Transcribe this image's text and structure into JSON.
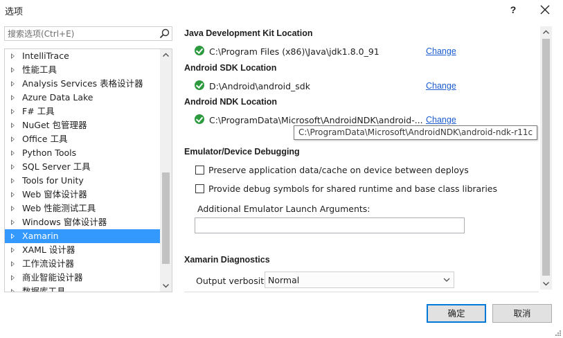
{
  "window": {
    "title": "选项",
    "help_label": "?"
  },
  "search": {
    "placeholder": "搜索选项(Ctrl+E)"
  },
  "tree": {
    "items": [
      {
        "label": "IntelliTrace"
      },
      {
        "label": "性能工具"
      },
      {
        "label": "Analysis Services 表格设计器"
      },
      {
        "label": "Azure Data Lake"
      },
      {
        "label": "F# 工具"
      },
      {
        "label": "NuGet 包管理器"
      },
      {
        "label": "Office 工具"
      },
      {
        "label": "Python Tools"
      },
      {
        "label": "SQL Server 工具"
      },
      {
        "label": "Tools for Unity"
      },
      {
        "label": "Web 窗体设计器"
      },
      {
        "label": "Web 性能测试工具"
      },
      {
        "label": "Windows 窗体设计器"
      },
      {
        "label": "Xamarin",
        "selected": true
      },
      {
        "label": "XAML 设计器"
      },
      {
        "label": "工作流设计器"
      },
      {
        "label": "商业智能设计器"
      },
      {
        "label": "数据库工具"
      }
    ]
  },
  "sdk": {
    "java_title": "Java Development Kit Location",
    "java_path": "C:\\Program Files (x86)\\Java\\jdk1.8.0_91",
    "android_sdk_title": "Android SDK Location",
    "android_sdk_path": "D:\\Android\\android_sdk",
    "android_ndk_title": "Android NDK Location",
    "android_ndk_path": "C:\\ProgramData\\Microsoft\\AndroidNDK\\android-...",
    "change_label": "Change",
    "ndk_tooltip": "C:\\ProgramData\\Microsoft\\AndroidNDK\\android-ndk-r11c"
  },
  "emulator": {
    "title": "Emulator/Device Debugging",
    "preserve_label": "Preserve application data/cache on device between deploys",
    "preserve_checked": false,
    "debug_symbols_label": "Provide debug symbols for shared runtime and base class libraries",
    "debug_symbols_checked": false,
    "args_label": "Additional Emulator Launch Arguments:",
    "args_value": ""
  },
  "diagnostics": {
    "title": "Xamarin Diagnostics",
    "verbosity_label": "Output verbosity:",
    "verbosity_value": "Normal"
  },
  "buttons": {
    "ok": "确定",
    "cancel": "取消"
  },
  "colors": {
    "accent": "#0078d7",
    "selection": "#3399ff",
    "link": "#1a5bd1",
    "success": "#2e9a3f"
  }
}
